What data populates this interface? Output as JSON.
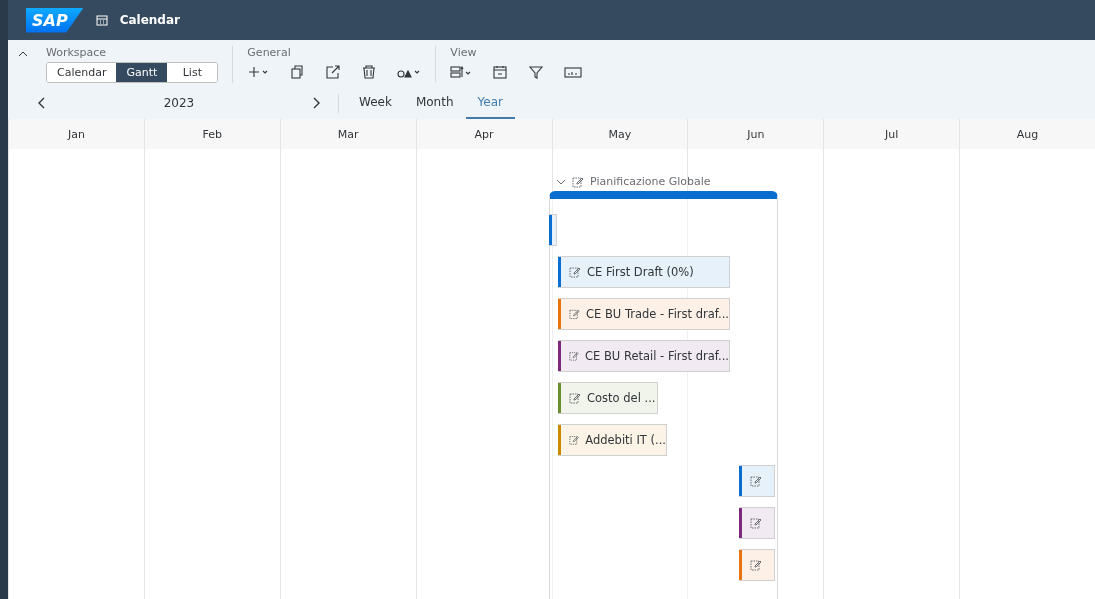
{
  "shell": {
    "logo": "SAP",
    "title": "Calendar"
  },
  "toolbar": {
    "workspace": {
      "label": "Workspace",
      "options": [
        {
          "label": "Calendar",
          "selected": false
        },
        {
          "label": "Gantt",
          "selected": true
        },
        {
          "label": "List",
          "selected": false
        }
      ]
    },
    "general": {
      "label": "General"
    },
    "view": {
      "label": "View"
    }
  },
  "navigation": {
    "year": "2023",
    "tabs": [
      {
        "label": "Week",
        "selected": false
      },
      {
        "label": "Month",
        "selected": false
      },
      {
        "label": "Year",
        "selected": true
      }
    ]
  },
  "months": [
    "Jan",
    "Feb",
    "Mar",
    "Apr",
    "May",
    "Jun",
    "Jul",
    "Aug"
  ],
  "gantt": {
    "group": {
      "label": "Pianificazione Globale",
      "expanded": true
    },
    "bars": [
      {
        "color": "#0a6ed1"
      },
      {
        "label": "CE First Draft (0%)",
        "color": "#0a6ed1"
      },
      {
        "label": "CE BU Trade - First draf...",
        "color": "#e9730c"
      },
      {
        "label": "CE BU Retail - First draf...",
        "color": "#7d2a7e"
      },
      {
        "label": "Costo del ...",
        "color": "#6a8f2e"
      },
      {
        "label": "Addebiti IT (...",
        "color": "#c98a00"
      },
      {
        "color": "#0a6ed1"
      },
      {
        "color": "#7d2a7e"
      },
      {
        "color": "#e9730c"
      }
    ]
  }
}
